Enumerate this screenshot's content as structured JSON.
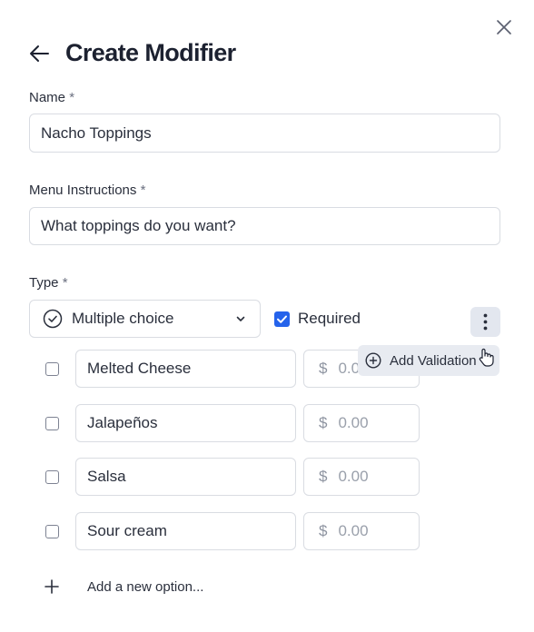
{
  "header": {
    "title": "Create Modifier"
  },
  "form": {
    "name": {
      "label": "Name",
      "required_mark": "*",
      "value": "Nacho Toppings"
    },
    "instructions": {
      "label": "Menu Instructions",
      "required_mark": "*",
      "value": "What toppings do you want?"
    },
    "type": {
      "label": "Type",
      "required_mark": "*",
      "selected": "Multiple choice"
    },
    "required": {
      "label": "Required",
      "checked": true
    },
    "options": [
      {
        "name": "Melted Cheese",
        "currency": "$",
        "price": "0.0",
        "checked": false
      },
      {
        "name": "Jalapeños",
        "currency": "$",
        "price": "0.00",
        "checked": false
      },
      {
        "name": "Salsa",
        "currency": "$",
        "price": "0.00",
        "checked": false
      },
      {
        "name": "Sour cream",
        "currency": "$",
        "price": "0.00",
        "checked": false
      }
    ],
    "add_option_label": "Add a new option..."
  },
  "menu_popup": {
    "add_validation_label": "Add Validation"
  },
  "icons": {
    "close": "close-icon",
    "back": "arrow-left-icon",
    "type": "check-circle-icon",
    "chevron": "chevron-down-icon",
    "kebab": "more-vertical-icon",
    "add_validation": "plus-circle-icon",
    "add_option": "plus-icon",
    "cursor": "hand-pointer-icon"
  },
  "colors": {
    "accent": "#2563eb",
    "border": "#d9dce2",
    "text": "#1f2433",
    "popup_bg": "#e8ebf1"
  }
}
